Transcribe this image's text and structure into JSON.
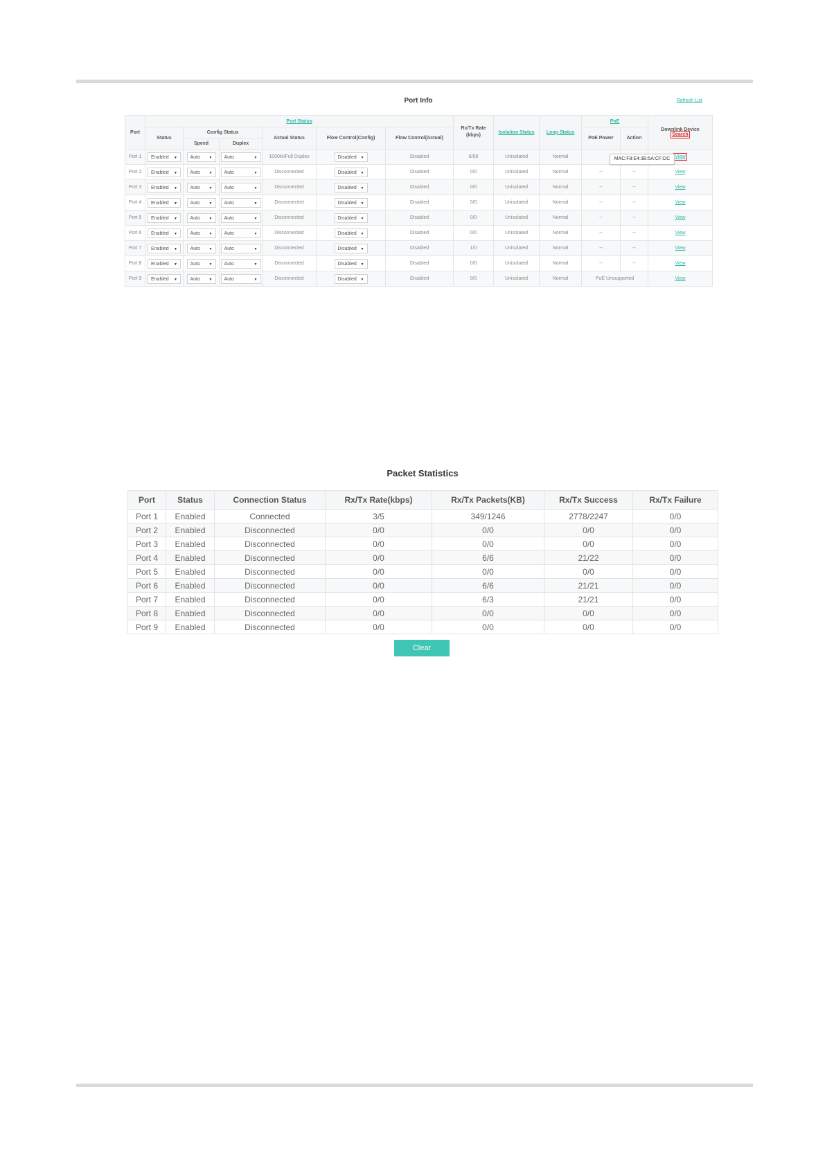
{
  "port_info": {
    "title": "Port Info",
    "refresh_label": "Refresh List",
    "headers": {
      "port": "Port",
      "port_status": "Port Status",
      "config_status": "Config Status",
      "status": "Status",
      "speed": "Speed",
      "duplex": "Duplex",
      "actual_status": "Actual Status",
      "flow_config": "Flow Control(Config)",
      "flow_actual": "Flow Control(Actual)",
      "rate": "Rx/Tx Rate (kbps)",
      "isolation": "Isolation Status",
      "loop": "Loop Status",
      "poe": "PoE",
      "poe_power": "PoE Power",
      "action": "Action",
      "downlink": "Downlink Device",
      "search": "Search"
    },
    "tooltip": "MAC:F8:E4:3B:5A:CF:DC",
    "rows": [
      {
        "port": "Port 1",
        "status": "Enabled",
        "speed": "Auto",
        "duplex": "Auto",
        "actual": "1000M/Full Duplex",
        "flow_config": "Disabled",
        "flow_actual": "Disabled",
        "rate": "8/58",
        "isolation": "Unisolated",
        "loop": "Normal",
        "poe_power": "",
        "action": "",
        "downlink": "View"
      },
      {
        "port": "Port 2",
        "status": "Enabled",
        "speed": "Auto",
        "duplex": "Auto",
        "actual": "Disconnected",
        "flow_config": "Disabled",
        "flow_actual": "Disabled",
        "rate": "0/0",
        "isolation": "Unisolated",
        "loop": "Normal",
        "poe_power": "--",
        "action": "--",
        "downlink": "View"
      },
      {
        "port": "Port 3",
        "status": "Enabled",
        "speed": "Auto",
        "duplex": "Auto",
        "actual": "Disconnected",
        "flow_config": "Disabled",
        "flow_actual": "Disabled",
        "rate": "0/0",
        "isolation": "Unisolated",
        "loop": "Normal",
        "poe_power": "--",
        "action": "--",
        "downlink": "View"
      },
      {
        "port": "Port 4",
        "status": "Enabled",
        "speed": "Auto",
        "duplex": "Auto",
        "actual": "Disconnected",
        "flow_config": "Disabled",
        "flow_actual": "Disabled",
        "rate": "0/0",
        "isolation": "Unisolated",
        "loop": "Normal",
        "poe_power": "--",
        "action": "--",
        "downlink": "View"
      },
      {
        "port": "Port 5",
        "status": "Enabled",
        "speed": "Auto",
        "duplex": "Auto",
        "actual": "Disconnected",
        "flow_config": "Disabled",
        "flow_actual": "Disabled",
        "rate": "0/0",
        "isolation": "Unisolated",
        "loop": "Normal",
        "poe_power": "--",
        "action": "--",
        "downlink": "View"
      },
      {
        "port": "Port 6",
        "status": "Enabled",
        "speed": "Auto",
        "duplex": "Auto",
        "actual": "Disconnected",
        "flow_config": "Disabled",
        "flow_actual": "Disabled",
        "rate": "0/0",
        "isolation": "Unisolated",
        "loop": "Normal",
        "poe_power": "--",
        "action": "--",
        "downlink": "View"
      },
      {
        "port": "Port 7",
        "status": "Enabled",
        "speed": "Auto",
        "duplex": "Auto",
        "actual": "Disconnected",
        "flow_config": "Disabled",
        "flow_actual": "Disabled",
        "rate": "1/0",
        "isolation": "Unisolated",
        "loop": "Normal",
        "poe_power": "--",
        "action": "--",
        "downlink": "View"
      },
      {
        "port": "Port 8",
        "status": "Enabled",
        "speed": "Auto",
        "duplex": "Auto",
        "actual": "Disconnected",
        "flow_config": "Disabled",
        "flow_actual": "Disabled",
        "rate": "0/0",
        "isolation": "Unisolated",
        "loop": "Normal",
        "poe_power": "--",
        "action": "--",
        "downlink": "View"
      },
      {
        "port": "Port 9",
        "status": "Enabled",
        "speed": "Auto",
        "duplex": "Auto",
        "actual": "Disconnected",
        "flow_config": "Disabled",
        "flow_actual": "Disabled",
        "rate": "0/0",
        "isolation": "Unisolated",
        "loop": "Normal",
        "poe_combined": "PoE Unsupported",
        "downlink": "View"
      }
    ]
  },
  "packet_stats": {
    "title": "Packet Statistics",
    "headers": [
      "Port",
      "Status",
      "Connection Status",
      "Rx/Tx Rate(kbps)",
      "Rx/Tx Packets(KB)",
      "Rx/Tx Success",
      "Rx/Tx Failure"
    ],
    "rows": [
      {
        "port": "Port 1",
        "status": "Enabled",
        "connection": "Connected",
        "rate": "3/5",
        "packets": "349/1246",
        "success": "2778/2247",
        "failure": "0/0"
      },
      {
        "port": "Port 2",
        "status": "Enabled",
        "connection": "Disconnected",
        "rate": "0/0",
        "packets": "0/0",
        "success": "0/0",
        "failure": "0/0"
      },
      {
        "port": "Port 3",
        "status": "Enabled",
        "connection": "Disconnected",
        "rate": "0/0",
        "packets": "0/0",
        "success": "0/0",
        "failure": "0/0"
      },
      {
        "port": "Port 4",
        "status": "Enabled",
        "connection": "Disconnected",
        "rate": "0/0",
        "packets": "6/6",
        "success": "21/22",
        "failure": "0/0"
      },
      {
        "port": "Port 5",
        "status": "Enabled",
        "connection": "Disconnected",
        "rate": "0/0",
        "packets": "0/0",
        "success": "0/0",
        "failure": "0/0"
      },
      {
        "port": "Port 6",
        "status": "Enabled",
        "connection": "Disconnected",
        "rate": "0/0",
        "packets": "6/6",
        "success": "21/21",
        "failure": "0/0"
      },
      {
        "port": "Port 7",
        "status": "Enabled",
        "connection": "Disconnected",
        "rate": "0/0",
        "packets": "6/3",
        "success": "21/21",
        "failure": "0/0"
      },
      {
        "port": "Port 8",
        "status": "Enabled",
        "connection": "Disconnected",
        "rate": "0/0",
        "packets": "0/0",
        "success": "0/0",
        "failure": "0/0"
      },
      {
        "port": "Port 9",
        "status": "Enabled",
        "connection": "Disconnected",
        "rate": "0/0",
        "packets": "0/0",
        "success": "0/0",
        "failure": "0/0"
      }
    ],
    "clear_label": "Clear"
  },
  "colors": {
    "accent": "#2bb5a3",
    "button": "#3ec5b3",
    "highlight": "#e0262a"
  },
  "icons": {
    "select_arrow": "caret-down-icon"
  }
}
